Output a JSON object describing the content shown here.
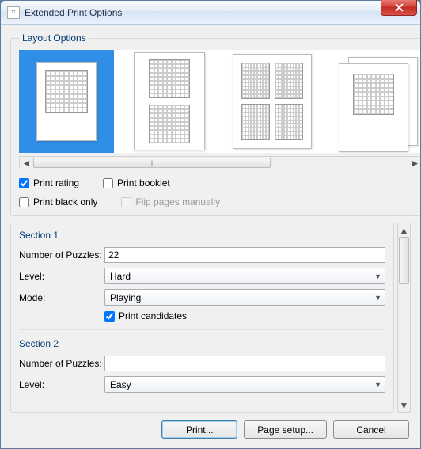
{
  "window": {
    "title": "Extended Print Options"
  },
  "layout": {
    "legend": "Layout Options",
    "cb_print_rating": "Print rating",
    "cb_print_booklet": "Print booklet",
    "cb_print_black_only": "Print black only",
    "cb_flip_pages": "Flip pages manually",
    "checked": {
      "print_rating": true,
      "print_booklet": false,
      "print_black_only": false,
      "flip_pages": false
    },
    "scroll_handle_glyph": "III"
  },
  "section1": {
    "title": "Section 1",
    "num_label": "Number of Puzzles:",
    "num_value": "22",
    "level_label": "Level:",
    "level_value": "Hard",
    "mode_label": "Mode:",
    "mode_value": "Playing",
    "print_candidates_label": "Print candidates",
    "print_candidates_checked": true
  },
  "section2": {
    "title": "Section 2",
    "num_label": "Number of Puzzles:",
    "num_value": "",
    "level_label": "Level:",
    "level_value": "Easy"
  },
  "buttons": {
    "print": "Print...",
    "page_setup": "Page setup...",
    "cancel": "Cancel"
  }
}
